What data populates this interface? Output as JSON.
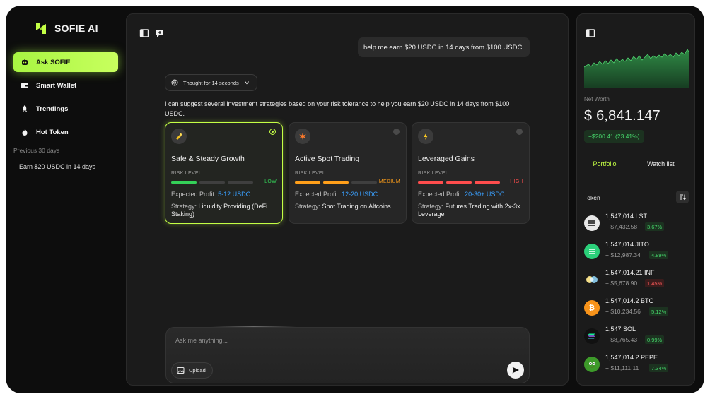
{
  "brand": {
    "name": "SOFIE AI"
  },
  "sidebar": {
    "items": [
      {
        "label": "Ask SOFIE",
        "icon": "bot-icon"
      },
      {
        "label": "Smart Wallet",
        "icon": "wallet-icon"
      },
      {
        "label": "Trendings",
        "icon": "rocket-icon"
      },
      {
        "label": "Hot Token",
        "icon": "flame-icon"
      }
    ],
    "history_label": "Previous 30 days",
    "history": [
      "Earn $20 USDC in 14 days"
    ]
  },
  "chat": {
    "user_message": "help me earn $20 USDC in 14 days from $100 USDC.",
    "thought_label": "Thought for 14 seconds",
    "answer": "I can suggest several investment strategies based on your risk tolerance to help you earn $20 USDC in 14 days from $100 USDC.",
    "cards": [
      {
        "title": "Safe & Steady Growth",
        "risk_label": "RISK LEVEL",
        "risk": "LOW",
        "risk_color": "#34d058",
        "filled_bars": 1,
        "profit_label": "Expected Profit:",
        "profit": "5-12 USDC",
        "strategy_label": "Strategy:",
        "strategy": "Liquidity Providing (DeFi Staking)",
        "icon": "shield-icon",
        "selected": true
      },
      {
        "title": "Active Spot Trading",
        "risk_label": "RISK LEVEL",
        "risk": "MEDIUM",
        "risk_color": "#ff9f1a",
        "filled_bars": 2,
        "profit_label": "Expected Profit:",
        "profit": "12-20 USDC",
        "strategy_label": "Strategy:",
        "strategy": "Spot Trading on Altcoins",
        "icon": "explosion-icon",
        "selected": false
      },
      {
        "title": "Leveraged Gains",
        "risk_label": "RISK LEVEL",
        "risk": "HIGH",
        "risk_color": "#ff4d4d",
        "filled_bars": 3,
        "profit_label": "Expected Profit:",
        "profit": "20-30+ USDC",
        "strategy_label": "Strategy:",
        "strategy": "Futures Trading with 2x-3x Leverage",
        "icon": "lightning-icon",
        "selected": false
      }
    ],
    "input_placeholder": "Ask me anything...",
    "upload_label": "Upload"
  },
  "wallet": {
    "net_worth_label": "Net Worth",
    "net_worth": "$ 6,841.147",
    "change": "+$200.41 (23.41%)",
    "tabs": [
      "Portfolio",
      "Watch list"
    ],
    "token_label": "Token",
    "tokens": [
      {
        "name": "1,547,014 LST",
        "value": "+ $7,432.58",
        "change": "3.67%",
        "direction": "up",
        "color": "#e8e8e8"
      },
      {
        "name": "1,547,014 JITO",
        "value": "+ $12,987.34",
        "change": "4.89%",
        "direction": "up",
        "color": "#2bd07a"
      },
      {
        "name": "1,547,014.21 INF",
        "value": "+ $5,678.90",
        "change": "1.45%",
        "direction": "down",
        "color": "#f5f0e0"
      },
      {
        "name": "1,547,014.2 BTC",
        "value": "+ $10,234.56",
        "change": "5.12%",
        "direction": "up",
        "color": "#f7931a"
      },
      {
        "name": "1,547 SOL",
        "value": "+ $8,765.43",
        "change": "0.99%",
        "direction": "up",
        "color": "#111111"
      },
      {
        "name": "1,547,014.2 PEPE",
        "value": "+ $11,111.11",
        "change": "7.34%",
        "direction": "up",
        "color": "#3d9a2a"
      }
    ]
  },
  "colors": {
    "accent": "#c4ff45",
    "profit_blue": "#3aa0ff",
    "positive": "#46d66b",
    "negative": "#ff5b5b"
  }
}
